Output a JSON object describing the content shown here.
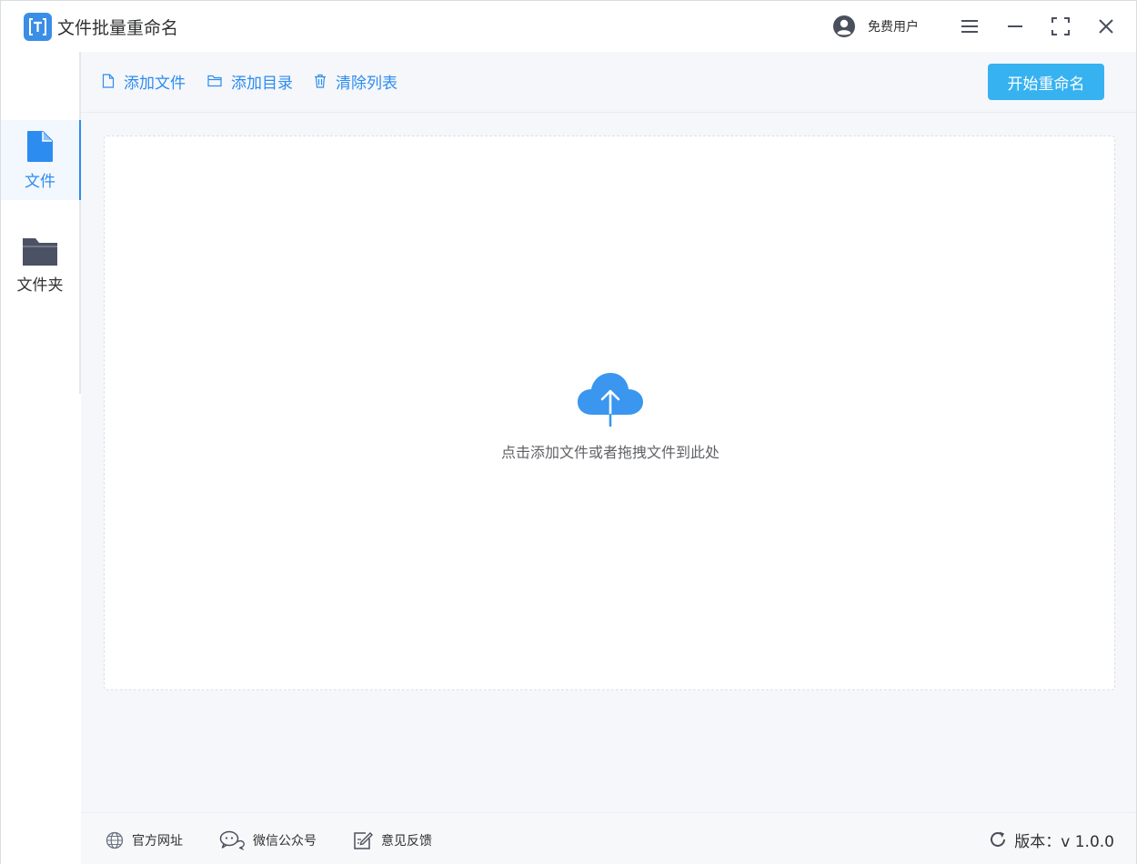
{
  "app": {
    "title": "文件批量重命名",
    "logo_letter": "T"
  },
  "user": {
    "name": "免费用户"
  },
  "window_controls": [
    "menu-icon",
    "minimize-icon",
    "maximize-icon",
    "close-icon"
  ],
  "sidebar": {
    "items": [
      {
        "label": "文件",
        "icon": "file-icon",
        "active": true
      },
      {
        "label": "文件夹",
        "icon": "folder-icon",
        "active": false
      }
    ]
  },
  "toolbar": {
    "add_file": "添加文件",
    "add_dir": "添加目录",
    "clear_list": "清除列表",
    "start": "开始重命名"
  },
  "dropzone": {
    "text": "点击添加文件或者拖拽文件到此处",
    "icon": "cloud-upload-icon"
  },
  "footer": {
    "website": "官方网址",
    "wechat": "微信公众号",
    "feedback": "意见反馈",
    "version": "版本：v 1.0.0"
  },
  "colors": {
    "accent": "#2d8cf0",
    "start_button": "#37b2f0",
    "sidebar_active_bg": "#f3f8fe",
    "main_bg": "#f5f7fa"
  }
}
